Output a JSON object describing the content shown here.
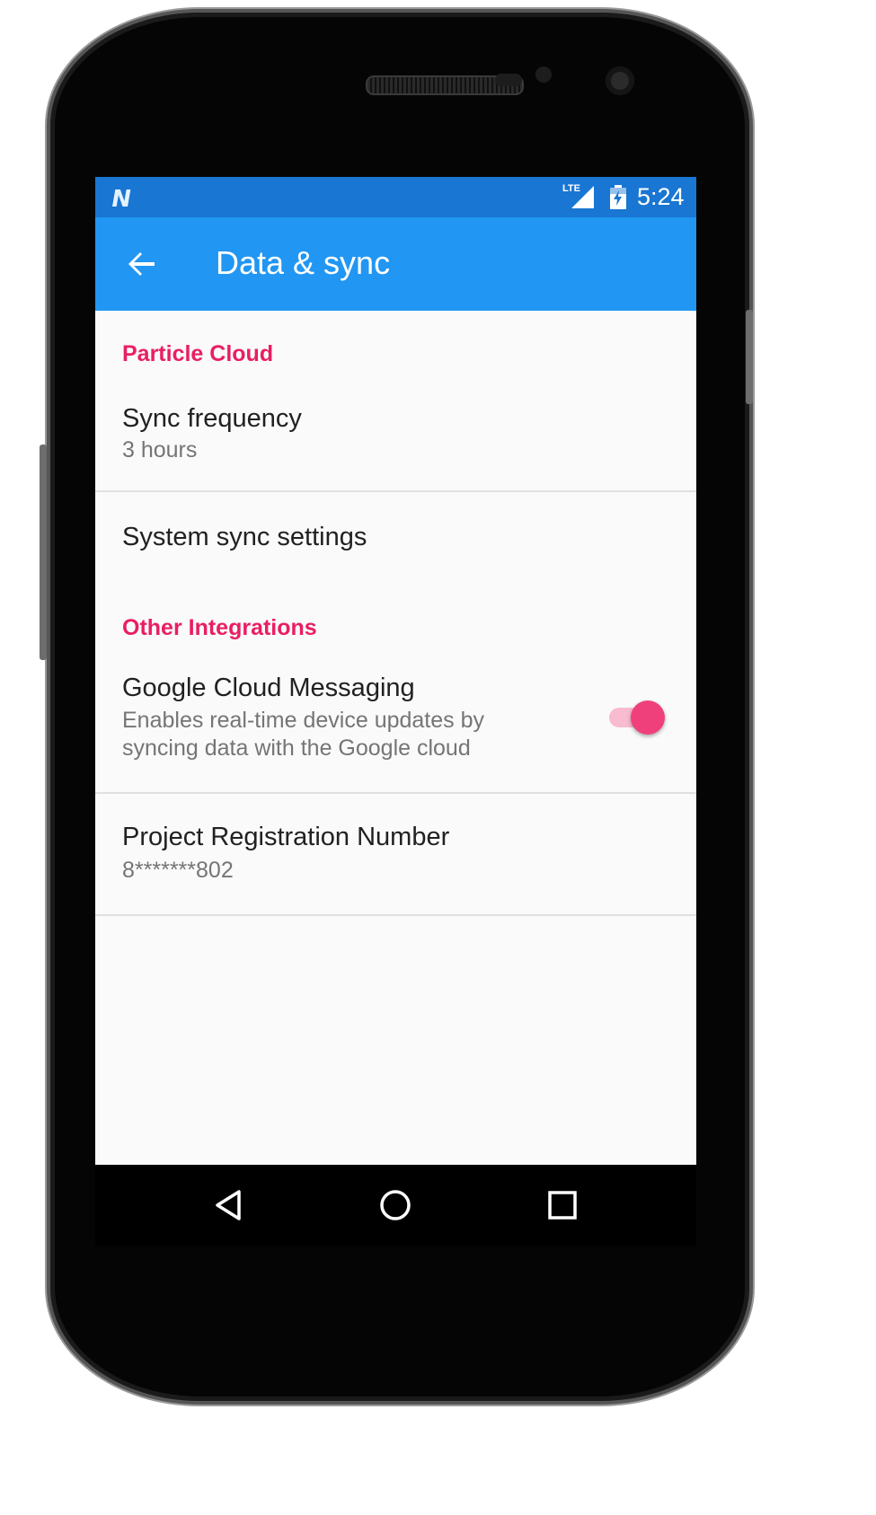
{
  "status_bar": {
    "time": "5:24",
    "network_label": "LTE",
    "icons": [
      "notification-n-icon",
      "lte-signal-icon",
      "battery-charging-icon"
    ]
  },
  "app_bar": {
    "title": "Data & sync",
    "back_icon": "arrow-back-icon"
  },
  "sections": [
    {
      "header": "Particle Cloud",
      "items": [
        {
          "title": "Sync frequency",
          "summary": "3 hours"
        },
        {
          "title": "System sync settings"
        }
      ]
    },
    {
      "header": "Other Integrations",
      "items": [
        {
          "title": "Google Cloud Messaging",
          "summary_lines": [
            "Enables real-time device updates by",
            "syncing data with the Google cloud"
          ],
          "switch_on": true
        },
        {
          "title": "Project Registration Number",
          "summary": "8*******802"
        }
      ]
    }
  ],
  "nav_bar": {
    "icons": [
      "back-triangle-icon",
      "home-circle-icon",
      "recents-square-icon"
    ]
  },
  "colors": {
    "status_bar": "#1976d2",
    "app_bar": "#2196f3",
    "accent": "#e91e63",
    "switch_thumb": "#f0407c",
    "switch_track": "#f8bbd0",
    "background": "#fafafa"
  }
}
